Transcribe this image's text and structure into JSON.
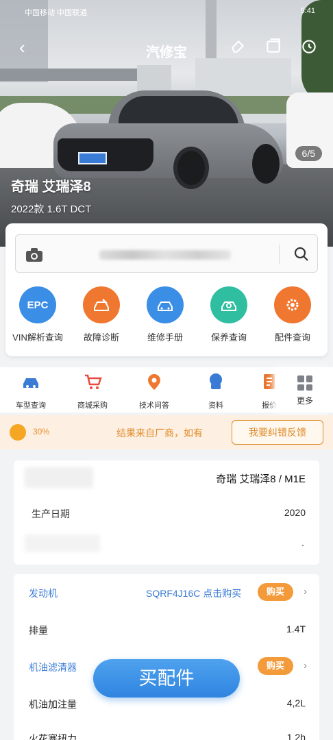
{
  "status_bar": {
    "left": "中国移动 中国联通",
    "right": "5:41"
  },
  "navbar": {
    "title": "汽修宝"
  },
  "hero": {
    "car_name": "奇瑞 艾瑞泽8",
    "car_subtitle": "2022款 1.6T DCT",
    "counter": "6/5"
  },
  "search": {
    "placeholder": ""
  },
  "features": [
    {
      "label": "VIN解析查询",
      "icon": "EPC",
      "color": "#3a8ee6"
    },
    {
      "label": "故障诊断",
      "icon": "car-repair",
      "color": "#f0772f"
    },
    {
      "label": "维修手册",
      "icon": "car-service",
      "color": "#3a8ee6"
    },
    {
      "label": "保养查询",
      "icon": "maintenance",
      "color": "#2fbfa0"
    },
    {
      "label": "配件查询",
      "icon": "gear-search",
      "color": "#f0772f"
    }
  ],
  "quick": [
    {
      "label": "车型查询",
      "color": "#3a7bd5"
    },
    {
      "label": "商城采购",
      "color": "#e84c3d"
    },
    {
      "label": "技术问答",
      "color": "#f0772f"
    },
    {
      "label": "资料",
      "color": "#3a7bd5"
    },
    {
      "label": "报价",
      "color": "#e8762f"
    }
  ],
  "more_label": "更多",
  "banner": {
    "percent": "30%",
    "message": "结果来自厂商，如有",
    "button": "我要纠错反馈"
  },
  "info1": {
    "model_value": "奇瑞 艾瑞泽8 / M1E",
    "year_label": "生产日期",
    "year_value": "2020",
    "extra_value": "."
  },
  "info2": {
    "rows": [
      {
        "key": "发动机",
        "code": "SQRF4J16C 点击购买",
        "buy": "购买"
      },
      {
        "key": "排量",
        "value": "1.4T"
      },
      {
        "key": "机油滤清器",
        "buy": "购买"
      },
      {
        "key": "机油加注量",
        "value": "4,2L"
      },
      {
        "key": "火花塞扭力",
        "value": "1 2h"
      }
    ]
  },
  "fab_label": "买配件",
  "watermark": ""
}
